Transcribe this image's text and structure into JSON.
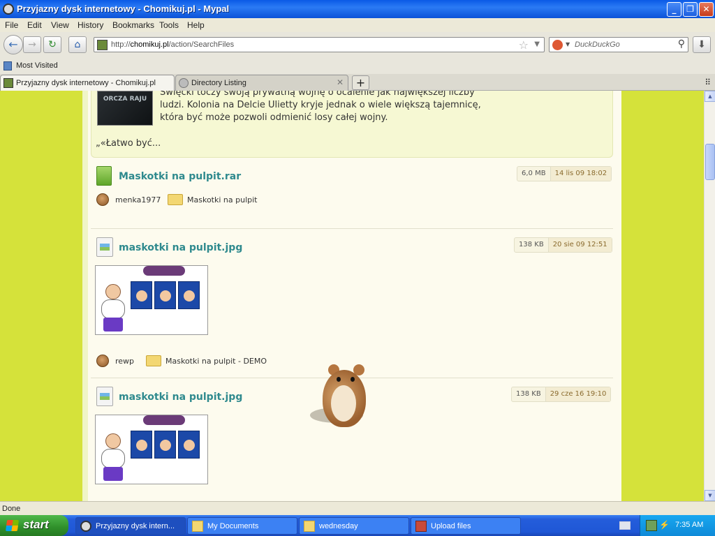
{
  "window": {
    "title": "Przyjazny dysk internetowy - Chomikuj.pl - Mypal",
    "buttons": {
      "minimize": "_",
      "maximize": "❐",
      "close": "✕"
    }
  },
  "menu": [
    "File",
    "Edit",
    "View",
    "History",
    "Bookmarks",
    "Tools",
    "Help"
  ],
  "nav": {
    "url_prefix": "http://",
    "url_domain": "chomikuj.pl",
    "url_path": "/action/SearchFiles",
    "search_placeholder": "DuckDuckGo",
    "download_icon": "⬇"
  },
  "bookmarks": {
    "most_visited": "Most Visited"
  },
  "tabs": [
    {
      "label": "Przyjazny dysk internetowy - Chomikuj.pl",
      "active": true
    },
    {
      "label": "Directory Listing",
      "active": false
    }
  ],
  "description": {
    "cover_text": "ORCZA RAJU",
    "lines": [
      "Święcki toczy swoją prywatną wojnę o ocalenie jak największej liczby",
      "ludzi. Kolonia na Delcie Ulietty kryje jednak o wiele większą tajemnicę,",
      "która być może pozwoli odmienić losy całej wojny."
    ],
    "more": "„«Łatwo być..."
  },
  "files": [
    {
      "name": "Maskotki na pulpit.rar",
      "size": "6,0 MB",
      "date": "14 lis 09 18:02",
      "owner": "menka1977",
      "folder": "Maskotki na pulpit"
    },
    {
      "name": "maskotki na pulpit.jpg",
      "size": "138 KB",
      "date": "20 sie 09 12:51",
      "owner": "rewp",
      "folder": "Maskotki na pulpit - DEMO"
    },
    {
      "name": "maskotki na pulpit.jpg",
      "size": "138 KB",
      "date": "29 cze 16 19:10"
    }
  ],
  "status": "Done",
  "taskbar": {
    "start": "start",
    "tasks": [
      "Przyjazny dysk intern...",
      "My Documents",
      "wednesday",
      "Upload files"
    ],
    "clock": "7:35 AM"
  }
}
